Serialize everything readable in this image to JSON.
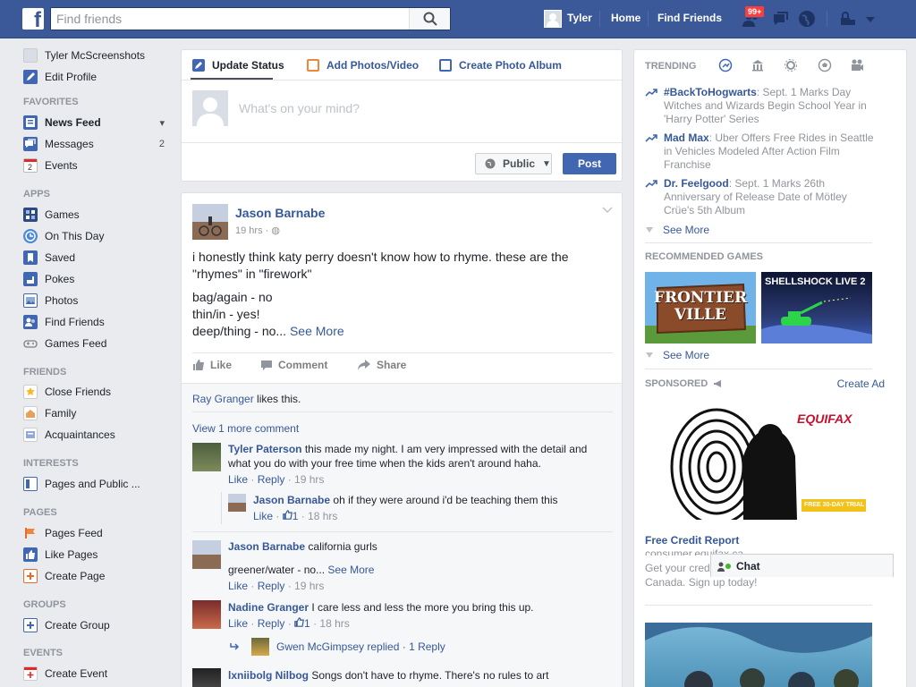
{
  "topbar": {
    "logo": "f",
    "search_placeholder": "Find friends",
    "user_name": "Tyler",
    "home": "Home",
    "find_friends": "Find Friends",
    "friend_requests_badge": "99+",
    "icons": [
      "friend-requests-icon",
      "messages-icon",
      "notifications-icon",
      "privacy-shortcuts-icon",
      "account-menu-icon"
    ]
  },
  "leftnav": {
    "profile_name": "Tyler McScreenshots",
    "edit_profile": "Edit Profile",
    "sections": {
      "favorites": "FAVORITES",
      "apps": "APPS",
      "friends": "FRIENDS",
      "interests": "INTERESTS",
      "pages": "PAGES",
      "groups": "GROUPS",
      "events": "EVENTS"
    },
    "favorites": [
      {
        "label": "News Feed",
        "count": ""
      },
      {
        "label": "Messages",
        "count": "2"
      },
      {
        "label": "Events",
        "count": ""
      }
    ],
    "apps": [
      "Games",
      "On This Day",
      "Saved",
      "Pokes",
      "Photos",
      "Find Friends",
      "Games Feed"
    ],
    "friends": [
      "Close Friends",
      "Family",
      "Acquaintances"
    ],
    "interests": [
      "Pages and Public ..."
    ],
    "pages": [
      "Pages Feed",
      "Like Pages",
      "Create Page"
    ],
    "groups": [
      "Create Group"
    ],
    "events": [
      "Create Event"
    ]
  },
  "composer": {
    "tabs": [
      "Update Status",
      "Add Photos/Video",
      "Create Photo Album"
    ],
    "placeholder": "What's on your mind?",
    "privacy": "Public",
    "post": "Post"
  },
  "post": {
    "author": "Jason Barnabe",
    "time": "19 hrs ·",
    "body_line1": "i honestly think katy perry doesn't know how to rhyme. these are the \"rhymes\" in \"firework\"",
    "body_line2": "bag/again - no",
    "body_line3": "thin/in - yes!",
    "body_line4": "deep/thing - no...",
    "see_more": "See More",
    "actions": {
      "like": "Like",
      "comment": "Comment",
      "share": "Share"
    },
    "likes_name": "Ray Granger",
    "likes_suffix": " likes this.",
    "view_more_comments": "View 1 more comment"
  },
  "comments": [
    {
      "author": "Tyler Paterson",
      "text_a": "this made my night. I am very impressed with the detail and",
      "text_b": "what you do with your free time when the kids aren't around haha.",
      "like": "Like",
      "reply": "Reply",
      "time": "19 hrs"
    },
    {
      "author": "Jason Barnabe",
      "text": "oh if they were around i'd be teaching them this",
      "like": "Like",
      "likes": "1",
      "time": "18 hrs"
    },
    {
      "author": "Jason Barnabe",
      "text": "california gurls",
      "text_b": "greener/water - no...",
      "see_more": "See More",
      "like": "Like",
      "reply": "Reply",
      "time": "19 hrs"
    },
    {
      "author": "Nadine Granger",
      "text": "I care less and less the more you bring this up.",
      "like": "Like",
      "reply": "Reply",
      "likes": "1",
      "time": "18 hrs"
    },
    {
      "author": "Gwen McGimpsey",
      "replied": "replied ·",
      "reply_count": "1 Reply"
    },
    {
      "author": "lxniibolg Nilbog",
      "text": "Songs don't have to rhyme. There's no rules to art"
    }
  ],
  "right": {
    "trending": "TRENDING",
    "trends": [
      {
        "topic": "#BackToHogwarts",
        "text": ": Sept. 1 Marks Day Witches and Wizards Begin School Year in 'Harry Potter' Series"
      },
      {
        "topic": "Mad Max",
        "text": ": Uber Offers Free Rides in Seattle in Vehicles Modeled After Action Film Franchise"
      },
      {
        "topic": "Dr. Feelgood",
        "text": ": Sept. 1 Marks 26th Anniversary of Release Date of Mötley Crüe's 5th Album"
      }
    ],
    "see_more": "See More",
    "recommended_games": "RECOMMENDED GAMES",
    "game1": "FRONTIER VILLE",
    "game2": "SHELLSHOCK LIVE 2",
    "see_more_games": "See More",
    "sponsored": "SPONSORED",
    "create_ad": "Create Ad",
    "ad_brand": "EQUIFAX",
    "ad_cta": "FREE 30-DAY TRIAL",
    "ad_title": "Free Credit Report",
    "ad_url": "consumer.equifax.ca",
    "ad_text_a": "Get your cred",
    "ad_text_b": "Canada. Sign up today!"
  },
  "chat": {
    "label": "Chat"
  }
}
